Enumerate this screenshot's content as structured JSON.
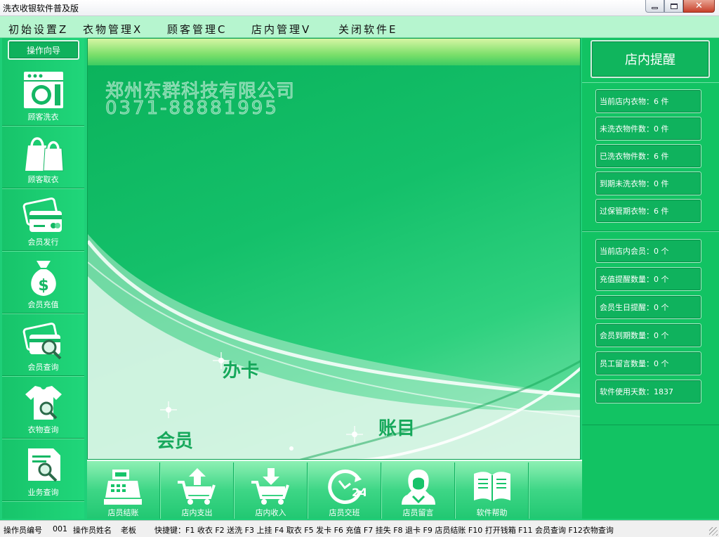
{
  "window": {
    "title": "洗衣收银软件普及版",
    "controls": {
      "minimize": "minimize-icon",
      "maximize": "maximize-icon",
      "close": "close-icon"
    }
  },
  "menu": [
    {
      "label": "初始设置Z"
    },
    {
      "label": "衣物管理X"
    },
    {
      "label": "顾客管理C"
    },
    {
      "label": "店内管理V"
    },
    {
      "label": "关闭软件E"
    }
  ],
  "sidebar": {
    "wizard_label": "操作向导",
    "items": [
      {
        "label": "顾客洗衣",
        "icon": "washing-machine-icon"
      },
      {
        "label": "顾客取衣",
        "icon": "shopping-bag-icon"
      },
      {
        "label": "会员发行",
        "icon": "member-card-icon"
      },
      {
        "label": "会员充值",
        "icon": "money-bag-icon"
      },
      {
        "label": "会员查询",
        "icon": "card-search-icon"
      },
      {
        "label": "衣物查询",
        "icon": "shirt-search-icon"
      },
      {
        "label": "业务查询",
        "icon": "document-search-icon"
      }
    ]
  },
  "main": {
    "company_name": "郑州东群科技有限公司",
    "company_phone": "0371-88881995",
    "art_words": [
      "办卡",
      "会员",
      "账目"
    ]
  },
  "bottom_toolbar": [
    {
      "label": "店员结账",
      "icon": "cash-register-icon"
    },
    {
      "label": "店内支出",
      "icon": "cart-upload-icon"
    },
    {
      "label": "店内收入",
      "icon": "cart-download-icon"
    },
    {
      "label": "店员交班",
      "icon": "clock-24-icon"
    },
    {
      "label": "店员留言",
      "icon": "person-message-icon"
    },
    {
      "label": "软件帮助",
      "icon": "help-book-icon"
    }
  ],
  "reminder_panel": {
    "title": "店内提醒",
    "clothes_stats": [
      {
        "text": "当前店内衣物：6 件"
      },
      {
        "text": "未洗衣物件数：0 件"
      },
      {
        "text": "已洗衣物件数：6 件"
      },
      {
        "text": "到期未洗衣物：0 件"
      },
      {
        "text": "过保管期衣物：6 件"
      }
    ],
    "member_stats": [
      {
        "text": "当前店内会员：0 个"
      },
      {
        "text": "充值提醒数量：0 个"
      },
      {
        "text": "会员生日提醒：0 个"
      },
      {
        "text": "会员到期数量：0 个"
      },
      {
        "text": "员工留言数量：0 个"
      },
      {
        "text": "软件使用天数：1837"
      }
    ]
  },
  "status_bar": {
    "operator_id_label": "操作员编号",
    "operator_id": "001",
    "operator_name_label": "操作员姓名",
    "operator_name": "老板",
    "shortcuts": "快捷键：F1 收衣 F2 送洗 F3 上挂 F4 取衣 F5 发卡 F6 充值 F7 挂失 F8 退卡 F9 店员结账  F10 打开钱箱 F11 会员查询 F12衣物查询"
  },
  "colors": {
    "primary_green": "#12c363",
    "menu_bg": "#b6f5cf",
    "button_green": "#0fb25d"
  }
}
